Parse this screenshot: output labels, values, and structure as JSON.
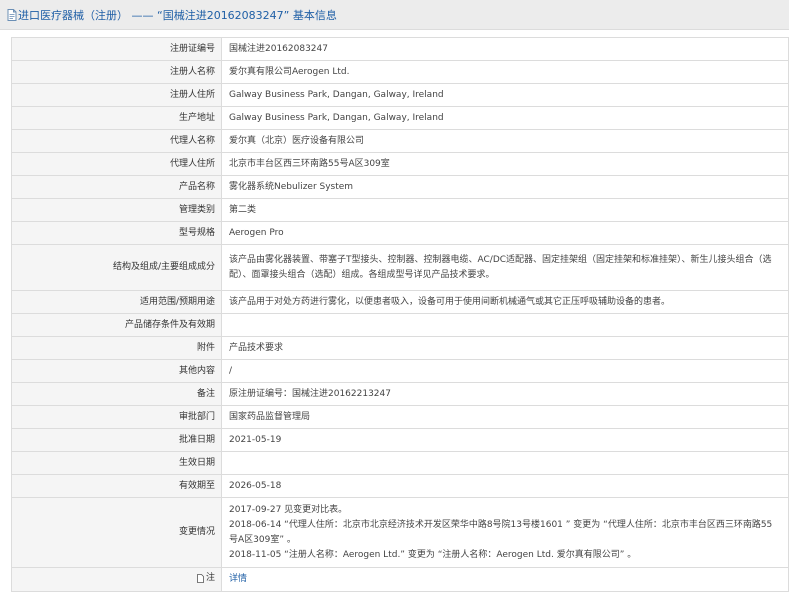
{
  "header": {
    "title": "进口医疗器械（注册） —— “国械注进20162083247” 基本信息"
  },
  "rows": [
    {
      "label": "注册证编号",
      "value": "国械注进20162083247"
    },
    {
      "label": "注册人名称",
      "value": "爱尔真有限公司Aerogen Ltd."
    },
    {
      "label": "注册人住所",
      "value": "Galway Business Park, Dangan, Galway, Ireland"
    },
    {
      "label": "生产地址",
      "value": "Galway Business Park, Dangan, Galway, Ireland"
    },
    {
      "label": "代理人名称",
      "value": "爱尔真（北京）医疗设备有限公司"
    },
    {
      "label": "代理人住所",
      "value": "北京市丰台区西三环南路55号A区309室"
    },
    {
      "label": "产品名称",
      "value": "雾化器系统Nebulizer System"
    },
    {
      "label": "管理类别",
      "value": "第二类"
    },
    {
      "label": "型号规格",
      "value": "Aerogen Pro"
    },
    {
      "label": "结构及组成/主要组成成分",
      "value": "该产品由雾化器装置、带塞子T型接头、控制器、控制器电缆、AC/DC适配器、固定挂架组（固定挂架和标准挂架）、新生儿接头组合（选配）、面罩接头组合（选配）组成。各组成型号详见产品技术要求。"
    },
    {
      "label": "适用范围/预期用途",
      "value": "该产品用于对处方药进行雾化，以便患者吸入，设备可用于使用间断机械通气或其它正压呼吸辅助设备的患者。"
    },
    {
      "label": "产品储存条件及有效期",
      "value": ""
    },
    {
      "label": "附件",
      "value": "产品技术要求"
    },
    {
      "label": "其他内容",
      "value": "/"
    },
    {
      "label": "备注",
      "value": "原注册证编号：国械注进20162213247"
    },
    {
      "label": "审批部门",
      "value": "国家药品监督管理局"
    },
    {
      "label": "批准日期",
      "value": "2021-05-19"
    },
    {
      "label": "生效日期",
      "value": ""
    },
    {
      "label": "有效期至",
      "value": "2026-05-18"
    }
  ],
  "changes": {
    "label": "变更情况",
    "lines": [
      "2017-09-27 见变更对比表。",
      "2018-06-14 “代理人住所：北京市北京经济技术开发区荣华中路8号院13号楼1601 ” 变更为 “代理人住所：北京市丰台区西三环南路55号A区309室” 。",
      "2018-11-05 “注册人名称：Aerogen Ltd.” 变更为 “注册人名称：Aerogen Ltd. 爱尔真有限公司” 。"
    ]
  },
  "note": {
    "label": "注",
    "link": "详情",
    "icon": "document-icon"
  }
}
